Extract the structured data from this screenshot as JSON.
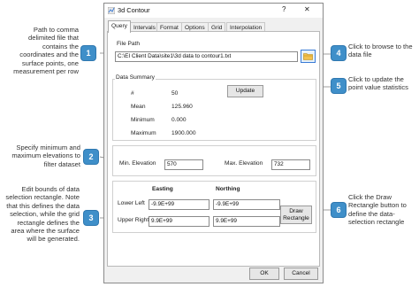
{
  "callouts": [
    {
      "num": "1",
      "text": "Path to comma delimited file that contains the coordinates and the surface points, one measurement per row"
    },
    {
      "num": "2",
      "text": "Specify minimum and maximum elevations to filter dataset"
    },
    {
      "num": "3",
      "text": "Edit bounds of data selection rectangle. Note that this defines the data selection, while the grid rectangle defines the area where the surface will be generated."
    },
    {
      "num": "4",
      "text": "Click to browse to the data file"
    },
    {
      "num": "5",
      "text": "Click to update the point value statistics"
    },
    {
      "num": "6",
      "text": "Click the Draw Rectangle button to define the data-selection rectangle"
    }
  ],
  "dialog": {
    "title": "3d Contour",
    "help": "?",
    "close": "✕",
    "tabs": [
      "Query",
      "Intervals",
      "Format",
      "Options",
      "Grid",
      "Interpolation"
    ],
    "active_tab": "Query"
  },
  "filepath": {
    "group_label": "File Path",
    "value": "C:\\EI Client Data\\site1\\3d data to contour1.txt"
  },
  "summary": {
    "group_label": "Data Summary",
    "update_button": "Update",
    "rows": [
      {
        "label": "#",
        "value": "50"
      },
      {
        "label": "Mean",
        "value": "125.960"
      },
      {
        "label": "Minimum",
        "value": "0.000"
      },
      {
        "label": "Maximum",
        "value": "1900.000"
      }
    ]
  },
  "elevation": {
    "min_label": "Min. Elevation",
    "min_value": "570",
    "max_label": "Max. Elevation",
    "max_value": "732"
  },
  "bounds": {
    "easting_header": "Easting",
    "northing_header": "Northing",
    "lower_left_label": "Lower Left",
    "upper_right_label": "Upper Right",
    "ll_easting": "-9.9E+99",
    "ll_northing": "-9.9E+99",
    "ur_easting": "9.9E+99",
    "ur_northing": "9.9E+99",
    "draw_button": "Draw Rectangle"
  },
  "footer": {
    "ok": "OK",
    "cancel": "Cancel"
  },
  "colors": {
    "callout": "#3f8fc9",
    "accent": "#3a7bd5"
  }
}
